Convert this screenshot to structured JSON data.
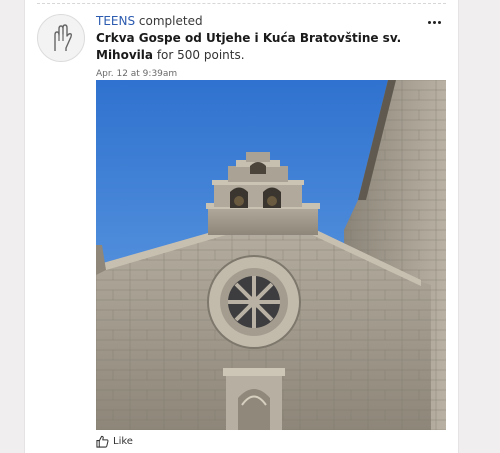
{
  "post": {
    "team_name": "TEENS",
    "verb": "completed",
    "place_name": "Crkva Gospe od Utjehe i Kuća Bratovštine sv. Mihovila",
    "points_text": "for 500 points.",
    "timestamp": "Apr. 12 at 9:39am"
  },
  "actions": {
    "like_label": "Like"
  },
  "icons": {
    "avatar": "raised-hand-icon",
    "more": "more-options-icon",
    "like": "thumbs-up-icon"
  },
  "colors": {
    "link": "#2c5bb0",
    "sky": "#3b7fd6",
    "stone": "#a59e92"
  }
}
